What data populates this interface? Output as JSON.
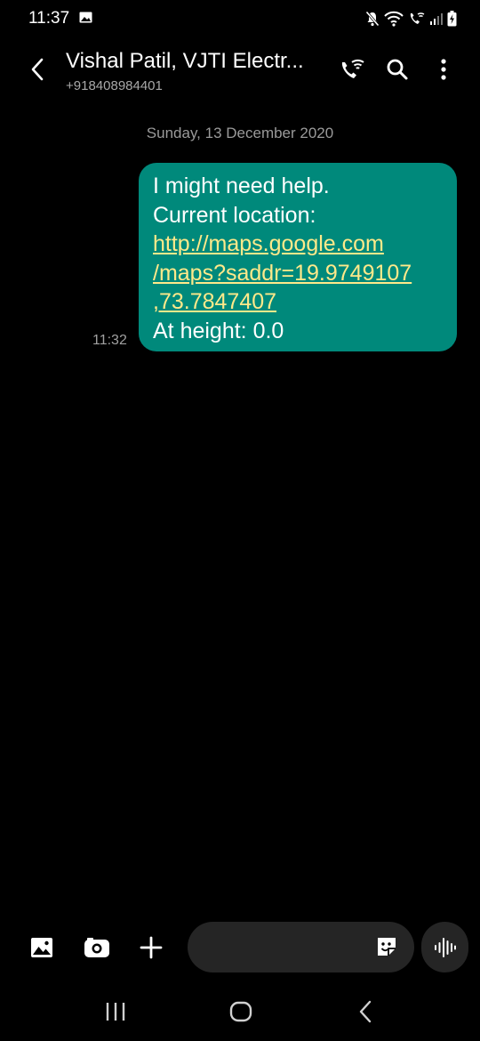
{
  "status_bar": {
    "time": "11:37",
    "icons": [
      "gallery-icon",
      "mute-icon",
      "wifi-icon",
      "wifi-calling-icon",
      "signal-icon",
      "battery-charging-icon"
    ]
  },
  "header": {
    "contact_name": "Vishal Patil, VJTI Electr...",
    "contact_number": "+918408984401",
    "icons": [
      "back-icon",
      "wifi-call-icon",
      "search-icon",
      "more-icon"
    ]
  },
  "conversation": {
    "date_separator": "Sunday, 13 December 2020",
    "messages": [
      {
        "time": "11:32",
        "line1": "I might need help.",
        "line2": "Current location:",
        "link_line1": "http://maps.google.com",
        "link_line2": "/maps?saddr=19.9749107",
        "link_line3": ",73.7847407",
        "line3": "At height: 0.0",
        "bubble_color": "#00897b",
        "link_color": "#ffe98a"
      }
    ]
  },
  "composer": {
    "placeholder": "",
    "icons": [
      "gallery-icon",
      "camera-icon",
      "plus-icon",
      "sticker-icon",
      "voice-wave-icon"
    ]
  },
  "nav_bar": {
    "icons": [
      "recents-icon",
      "home-icon",
      "back-icon"
    ]
  }
}
